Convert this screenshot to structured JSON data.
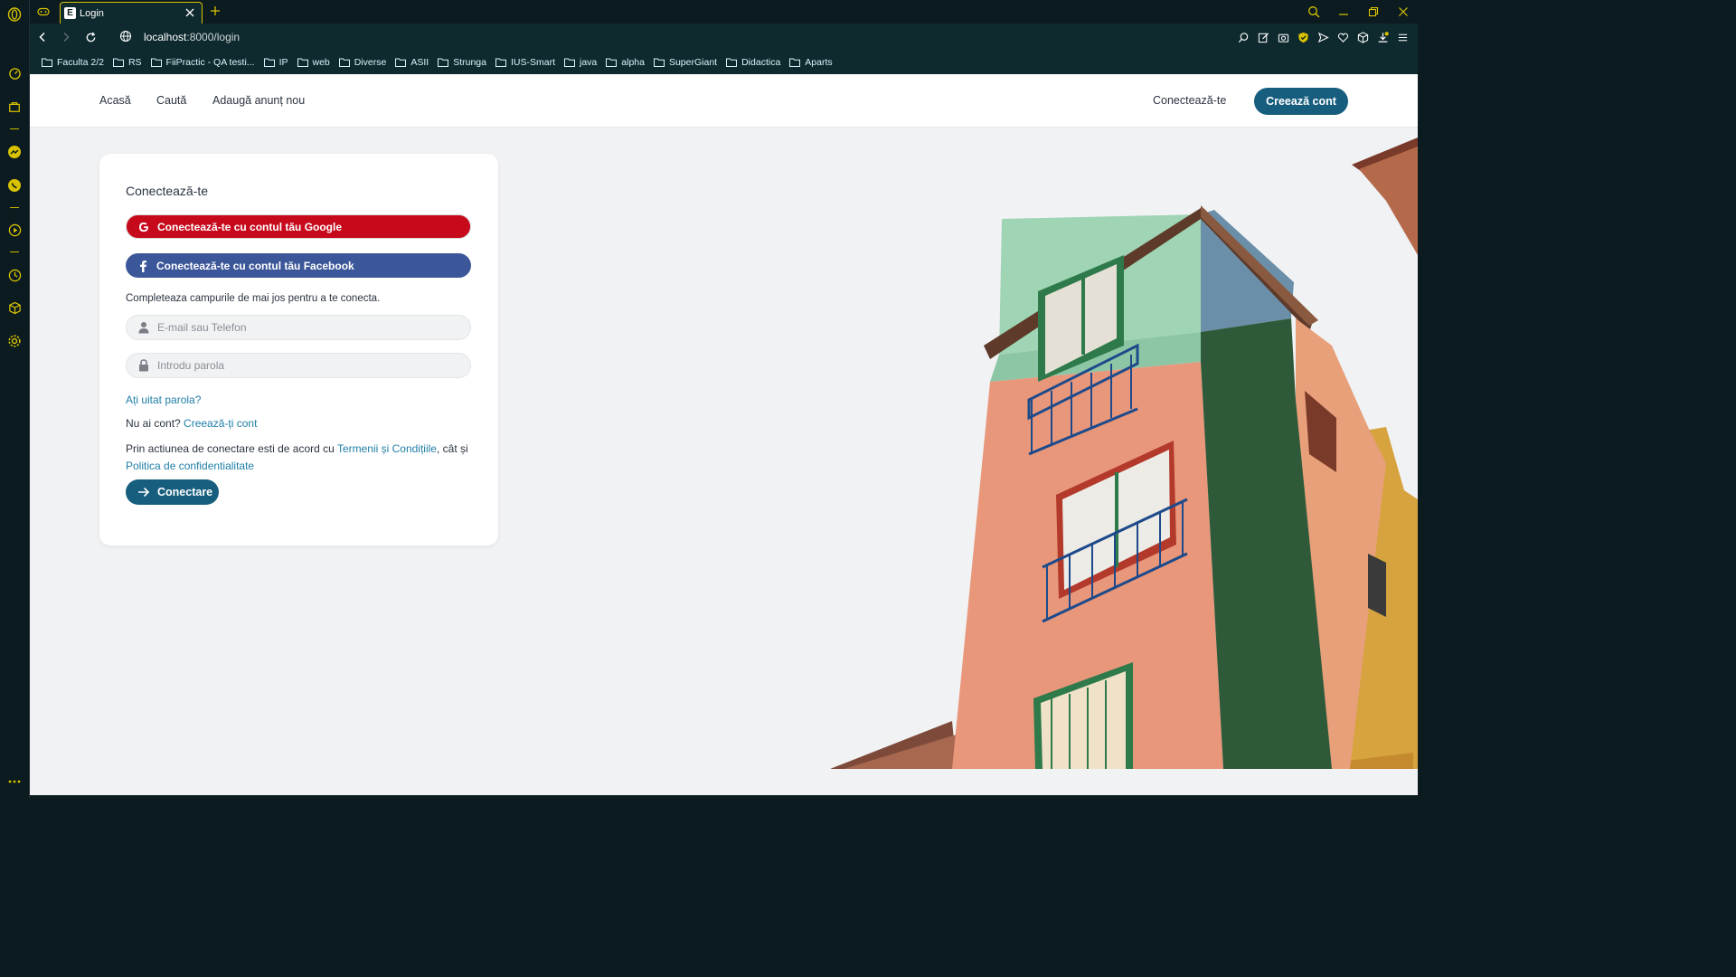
{
  "browser": {
    "tab_title": "Login",
    "tab_favicon_letter": "E",
    "url_host": "localhost",
    "url_rest": ":8000/login",
    "bookmarks": [
      "Faculta 2/2",
      "RS",
      "FiiPractic - QA testi...",
      "IP",
      "web",
      "Diverse",
      "ASII",
      "Strunga",
      "IUS-Smart",
      "java",
      "alpha",
      "SuperGiant",
      "Didactica",
      "Aparts"
    ]
  },
  "nav": {
    "home": "Acasă",
    "search": "Caută",
    "add_listing": "Adaugă anunț nou",
    "login": "Conectează-te",
    "create_account": "Creează cont"
  },
  "login": {
    "title": "Conectează-te",
    "google_button": "Conectează-te cu contul tău Google",
    "facebook_button": "Conectează-te cu contul tău Facebook",
    "instructions": "Completeaza campurile de mai jos pentru a te conecta.",
    "email_placeholder": "E-mail sau Telefon",
    "password_placeholder": "Introdu parola",
    "forgot_password": "Ați uitat parola?",
    "no_account_text": "Nu ai cont?",
    "create_account_link": "Creează-ți cont",
    "terms_prefix": "Prin actiunea de conectare esti de acord cu",
    "terms_link": "Termenii și Condițiile",
    "terms_middle": "cât și",
    "privacy_link": "Politica de confidentialitate",
    "submit": "Conectare"
  },
  "colors": {
    "primary": "#175e7e",
    "link": "#1f7ea6",
    "google": "#c7091c",
    "facebook": "#3c5799",
    "browser_accent": "#d9c300"
  }
}
